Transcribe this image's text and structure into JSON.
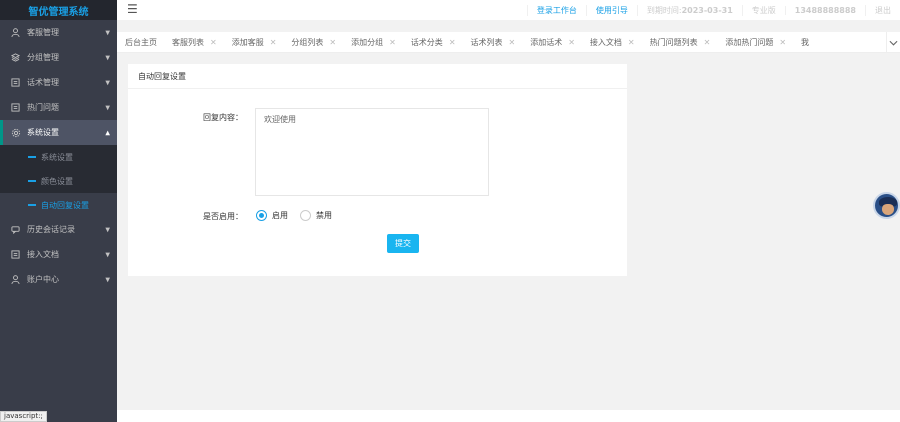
{
  "brand": "智优管理系统",
  "header": {
    "menu_icon": "hamburger-icon",
    "links": [
      "登录工作台",
      "使用引导"
    ],
    "expire_label": "到期时间:",
    "expire_date": "2023-03-31",
    "edition": "专业版",
    "phone": "13488888888",
    "logout": "退出"
  },
  "sidebar": {
    "items": [
      {
        "label": "客服管理",
        "icon": "user-icon"
      },
      {
        "label": "分组管理",
        "icon": "layers-icon"
      },
      {
        "label": "话术管理",
        "icon": "document-icon"
      },
      {
        "label": "热门问题",
        "icon": "document-icon"
      },
      {
        "label": "系统设置",
        "icon": "gear-icon"
      },
      {
        "label": "历史会话记录",
        "icon": "chat-icon"
      },
      {
        "label": "接入文档",
        "icon": "document-icon"
      },
      {
        "label": "账户中心",
        "icon": "user-icon"
      }
    ],
    "submenu": [
      "系统设置",
      "颜色设置",
      "自动回复设置"
    ]
  },
  "tabs": [
    "后台主页",
    "客服列表",
    "添加客服",
    "分组列表",
    "添加分组",
    "话术分类",
    "话术列表",
    "添加话术",
    "接入文档",
    "热门问题列表",
    "添加热门问题",
    "我"
  ],
  "card": {
    "title": "自动回复设置",
    "reply_label": "回复内容：",
    "reply_value": "欢迎使用",
    "enable_label": "是否启用：",
    "options": [
      "启用",
      "禁用"
    ],
    "selected": "启用",
    "submit": "提交"
  },
  "status_bar": "javascript:;",
  "colors": {
    "accent": "#19a0e6",
    "sidebar": "#393d49",
    "brand_bg": "#23262e",
    "button": "#19b5f0"
  }
}
